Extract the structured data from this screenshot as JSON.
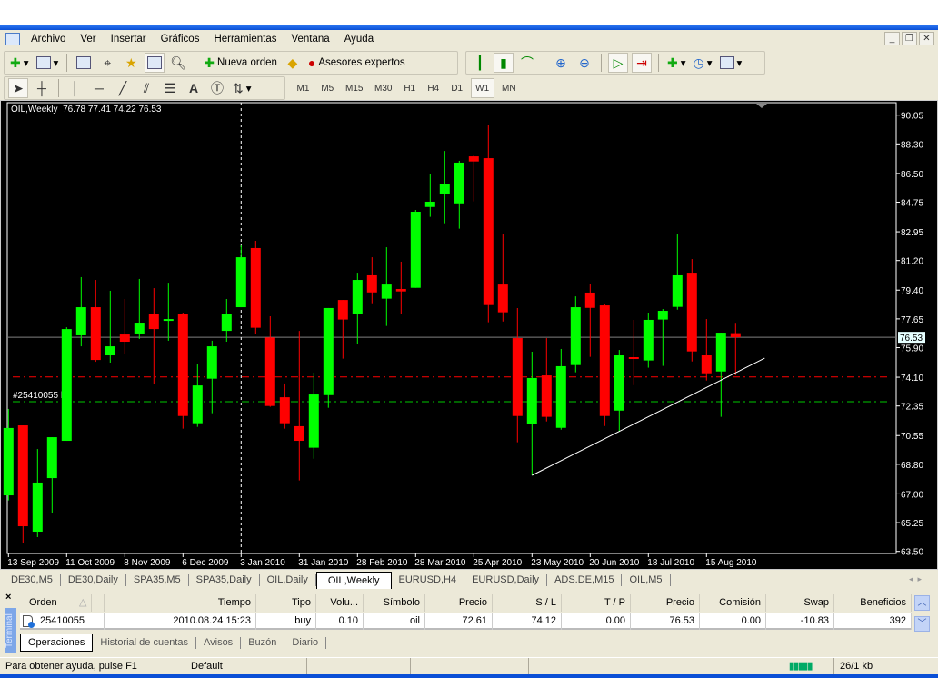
{
  "menu": {
    "items": [
      "Archivo",
      "Ver",
      "Insertar",
      "Gráficos",
      "Herramientas",
      "Ventana",
      "Ayuda"
    ]
  },
  "toolbar": {
    "new_order": "Nueva orden",
    "experts": "Asesores expertos"
  },
  "timeframes": [
    "M1",
    "M5",
    "M15",
    "M30",
    "H1",
    "H4",
    "D1",
    "W1",
    "MN"
  ],
  "active_timeframe": "W1",
  "chart_tabs": [
    "DE30,M5",
    "DE30,Daily",
    "SPA35,M5",
    "SPA35,Daily",
    "OIL,Daily",
    "OIL,Weekly",
    "EURUSD,H4",
    "EURUSD,Daily",
    "ADS.DE,M15",
    "OIL,M5"
  ],
  "active_chart_tab": "OIL,Weekly",
  "terminal": {
    "side_label": "Terminal",
    "columns": [
      "Orden",
      "Tiempo",
      "Tipo",
      "Volu...",
      "Símbolo",
      "Precio",
      "S / L",
      "T / P",
      "Precio",
      "Comisión",
      "Swap",
      "Beneficios"
    ],
    "sort_indicator": "△",
    "rows": [
      [
        "25410055",
        "2010.08.24 15:23",
        "buy",
        "0.10",
        "oil",
        "72.61",
        "74.12",
        "0.00",
        "76.53",
        "0.00",
        "-10.83",
        "392"
      ]
    ],
    "tabs": [
      "Operaciones",
      "Historial de cuentas",
      "Avisos",
      "Buzón",
      "Diario"
    ],
    "active_tab": "Operaciones"
  },
  "status": {
    "help": "Para obtener ayuda, pulse F1",
    "profile": "Default",
    "traffic": "26/1 kb"
  },
  "colors": {
    "bull": "#00ff00",
    "bear": "#ff0000",
    "sl_line": "#ff0000",
    "order_line": "#00c800",
    "bid_line": "#808080"
  },
  "chart_data": {
    "type": "candlestick",
    "title": "OIL,Weekly",
    "ohlc_label": "76.78 77.41 74.22 76.53",
    "order_label": "#25410055 b",
    "bid": 76.53,
    "ylim": [
      63.5,
      90.05
    ],
    "yticks": [
      "90.05",
      "88.30",
      "86.50",
      "84.75",
      "82.95",
      "81.20",
      "79.40",
      "77.65",
      "75.90",
      "74.10",
      "72.35",
      "70.55",
      "68.80",
      "67.00",
      "65.25",
      "63.50"
    ],
    "xticks": [
      {
        "i": 0,
        "label": "13 Sep 2009"
      },
      {
        "i": 4,
        "label": "11 Oct 2009"
      },
      {
        "i": 8,
        "label": "8 Nov 2009"
      },
      {
        "i": 12,
        "label": "6 Dec 2009"
      },
      {
        "i": 16,
        "label": "3 Jan 2010"
      },
      {
        "i": 20,
        "label": "31 Jan 2010"
      },
      {
        "i": 24,
        "label": "28 Feb 2010"
      },
      {
        "i": 28,
        "label": "28 Mar 2010"
      },
      {
        "i": 32,
        "label": "25 Apr 2010"
      },
      {
        "i": 36,
        "label": "23 May 2010"
      },
      {
        "i": 40,
        "label": "20 Jun 2010"
      },
      {
        "i": 44,
        "label": "18 Jul 2010"
      },
      {
        "i": 48,
        "label": "15 Aug 2010"
      }
    ],
    "hlines": [
      {
        "name": "stop-loss-line",
        "price": 74.12,
        "color": "#ff0000"
      },
      {
        "name": "order-open-line",
        "price": 72.61,
        "color": "#00c800"
      }
    ],
    "vline_index": 16,
    "trendline": [
      [
        36,
        68.13
      ],
      [
        52,
        75.26
      ]
    ],
    "candles": [
      [
        66.91,
        72.17,
        66.6,
        71.01
      ],
      [
        71.17,
        71.17,
        64.0,
        65.03
      ],
      [
        64.7,
        69.73,
        64.37,
        67.69
      ],
      [
        67.96,
        70.45,
        65.81,
        70.45
      ],
      [
        70.23,
        77.14,
        70.23,
        77.03
      ],
      [
        76.65,
        80.19,
        75.98,
        78.36
      ],
      [
        78.36,
        80.02,
        75.04,
        75.15
      ],
      [
        75.43,
        79.36,
        74.99,
        75.98
      ],
      [
        76.7,
        78.86,
        75.54,
        76.26
      ],
      [
        76.76,
        80.08,
        76.43,
        77.42
      ],
      [
        77.92,
        79.52,
        73.66,
        77.03
      ],
      [
        77.53,
        79.85,
        76.32,
        77.64
      ],
      [
        77.92,
        78.03,
        70.97,
        71.74
      ],
      [
        71.3,
        74.93,
        71.08,
        73.6
      ],
      [
        74.01,
        76.32,
        71.91,
        75.98
      ],
      [
        76.92,
        78.86,
        76.26,
        77.97
      ],
      [
        78.36,
        82.12,
        78.36,
        81.4
      ],
      [
        81.96,
        82.4,
        76.72,
        77.11
      ],
      [
        76.52,
        77.81,
        72.3,
        72.35
      ],
      [
        72.88,
        73.72,
        70.97,
        71.3
      ],
      [
        71.12,
        76.92,
        67.82,
        70.23
      ],
      [
        69.81,
        74.38,
        69.14,
        73.05
      ],
      [
        73.01,
        78.31,
        72.24,
        78.31
      ],
      [
        78.8,
        78.8,
        75.23,
        77.61
      ],
      [
        77.94,
        80.46,
        76.11,
        80.02
      ],
      [
        80.3,
        81.4,
        78.6,
        79.26
      ],
      [
        78.88,
        82.01,
        77.22,
        79.74
      ],
      [
        79.47,
        81.13,
        77.94,
        79.32
      ],
      [
        79.54,
        84.28,
        79.54,
        84.17
      ],
      [
        84.46,
        86.44,
        83.86,
        84.78
      ],
      [
        85.24,
        87.87,
        83.47,
        85.83
      ],
      [
        84.68,
        87.27,
        83.14,
        87.16
      ],
      [
        87.54,
        87.65,
        84.8,
        87.23
      ],
      [
        87.43,
        89.48,
        77.44,
        78.49
      ],
      [
        79.74,
        82.84,
        77.49,
        78.05
      ],
      [
        76.48,
        78.31,
        70.14,
        71.74
      ],
      [
        71.24,
        75.65,
        68.13,
        74.05
      ],
      [
        74.21,
        76.48,
        71.41,
        71.69
      ],
      [
        71.02,
        75.82,
        70.91,
        74.77
      ],
      [
        74.84,
        79.02,
        74.4,
        78.36
      ],
      [
        79.25,
        79.8,
        75.34,
        78.32
      ],
      [
        78.47,
        78.53,
        71.13,
        71.74
      ],
      [
        72.07,
        75.76,
        70.8,
        75.43
      ],
      [
        75.32,
        77.59,
        73.62,
        75.21
      ],
      [
        75.12,
        78.03,
        74.68,
        77.59
      ],
      [
        77.61,
        78.25,
        74.79,
        78.14
      ],
      [
        78.38,
        82.79,
        78.21,
        80.3
      ],
      [
        80.46,
        81.29,
        75.06,
        75.67
      ],
      [
        75.43,
        77.64,
        73.9,
        74.34
      ],
      [
        74.45,
        76.81,
        71.69,
        76.81
      ],
      [
        76.78,
        77.41,
        74.22,
        76.53
      ]
    ]
  }
}
